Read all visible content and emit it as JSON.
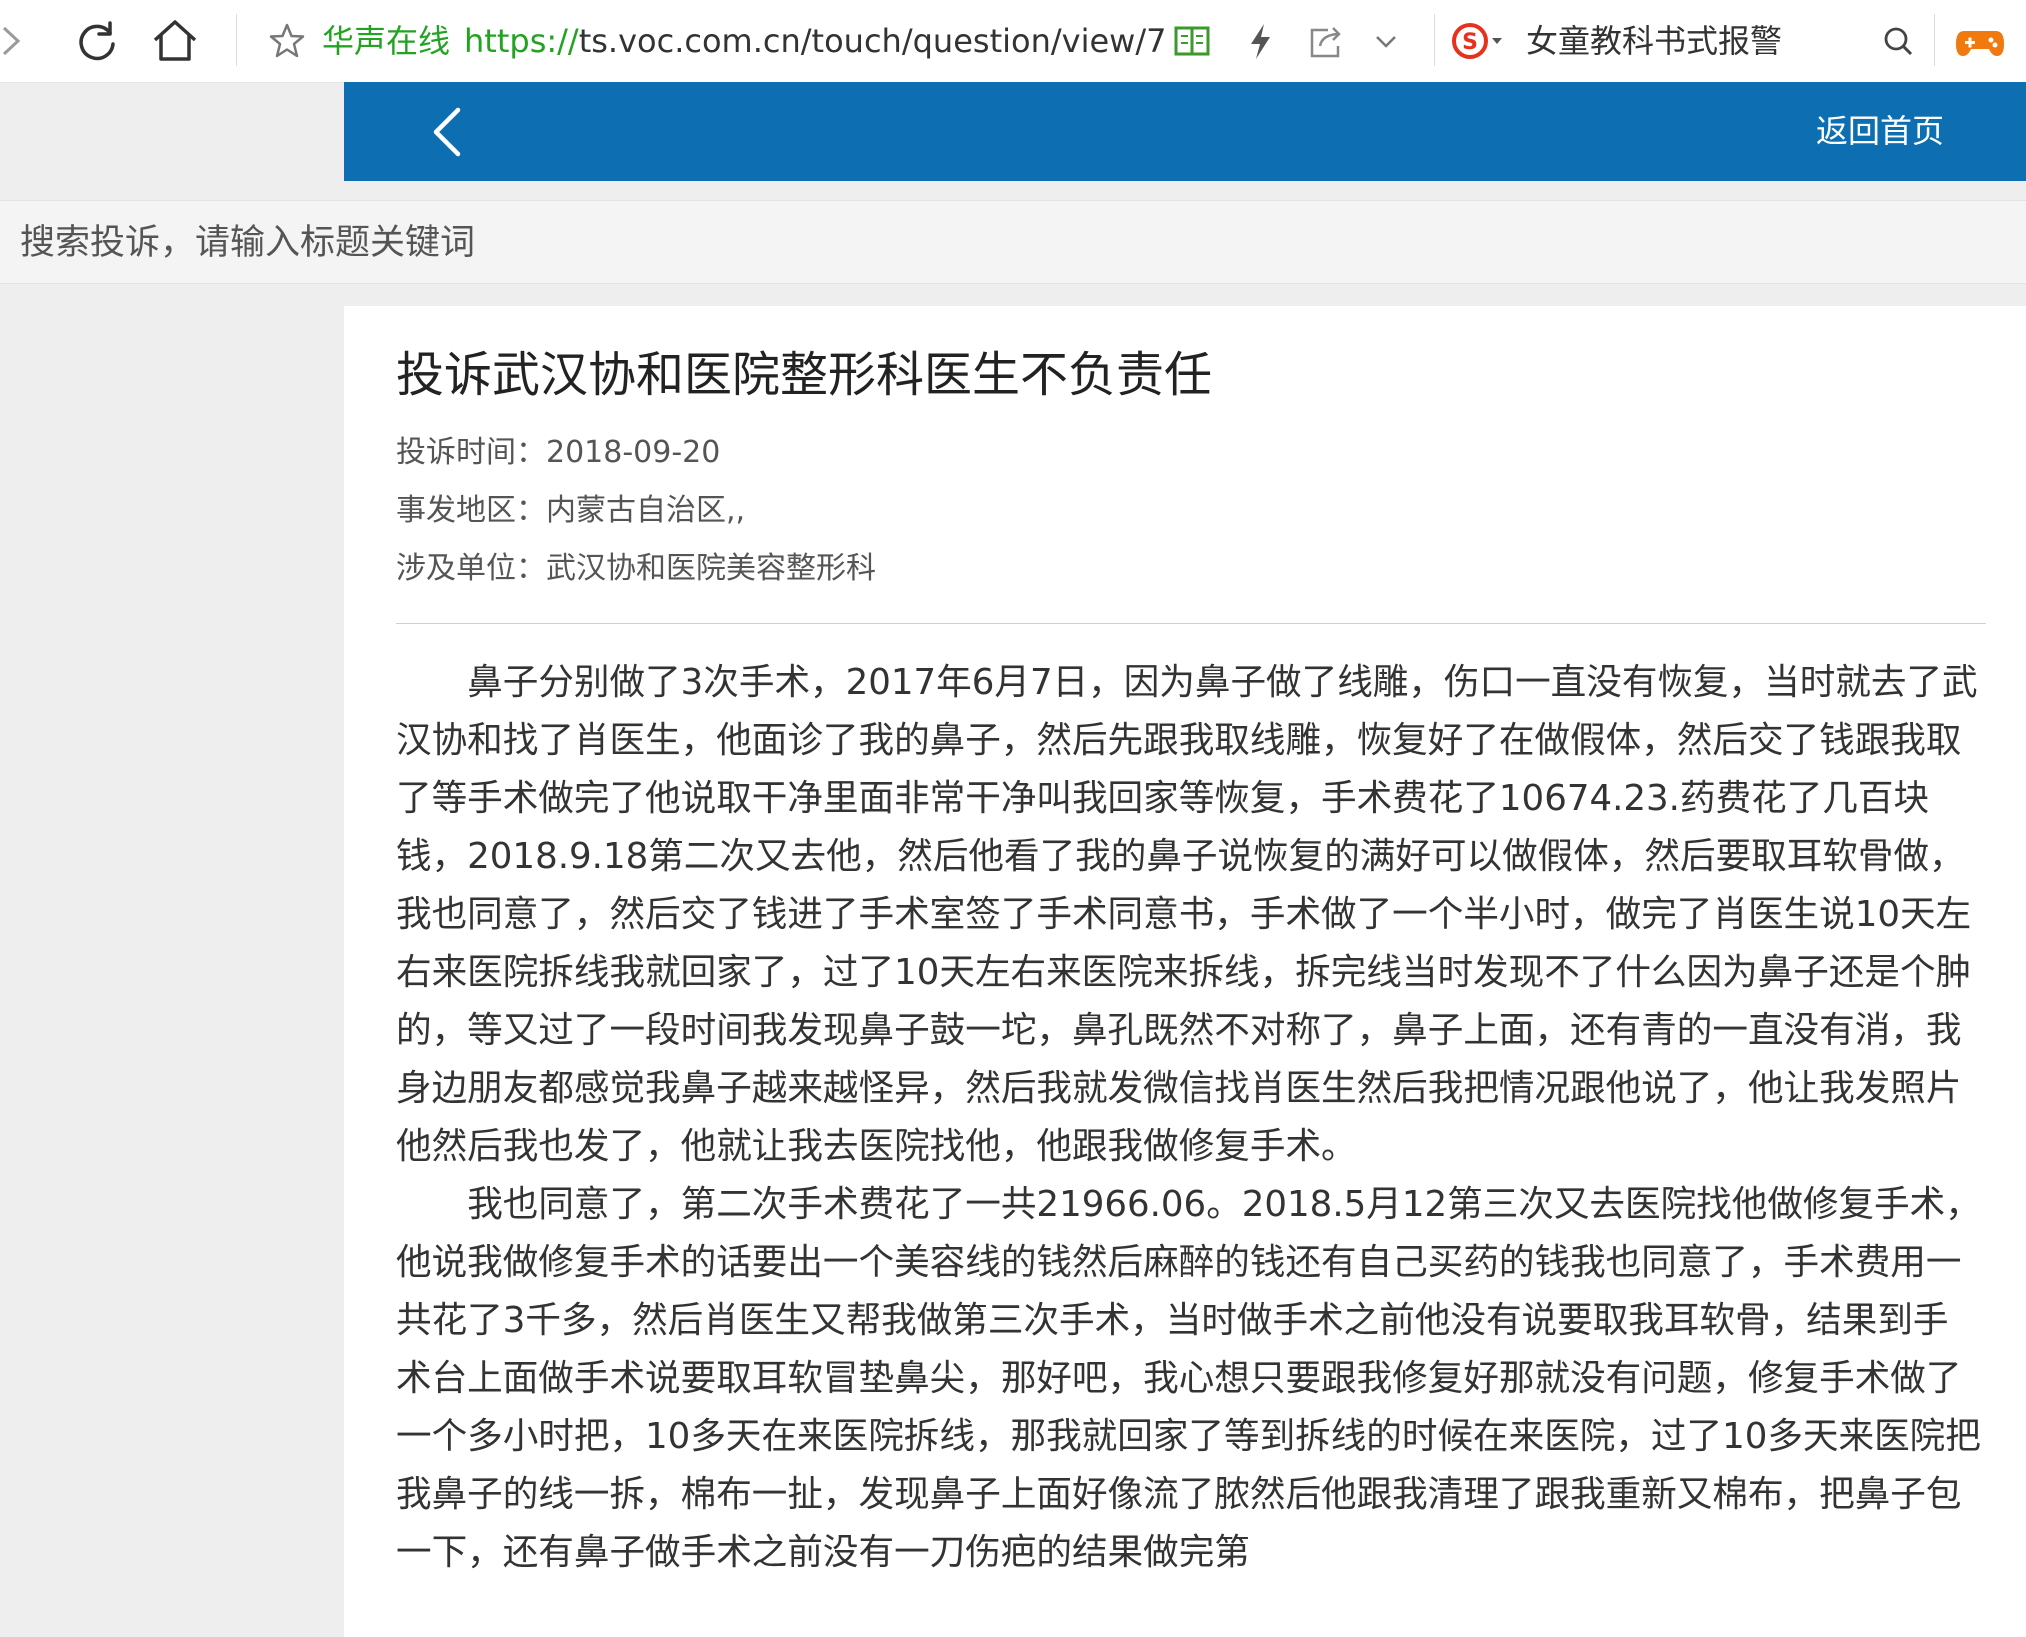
{
  "browser": {
    "site_name": "华声在线",
    "url_scheme": "https://",
    "url_rest": "ts.voc.com.cn/touch/question/view/7",
    "search_engine_text": "女童教科书式报警"
  },
  "header": {
    "home_link": "返回首页"
  },
  "search": {
    "placeholder": "搜索投诉，请输入标题关键词"
  },
  "article": {
    "title": "投诉武汉协和医院整形科医生不负责任",
    "time_label": "投诉时间：",
    "time_value": "2018-09-20",
    "region_label": "事发地区：",
    "region_value": "内蒙古自治区,,",
    "unit_label": "涉及单位：",
    "unit_value": "武汉协和医院美容整形科",
    "paragraphs": [
      "鼻子分别做了3次手术，2017年6月7日，因为鼻子做了线雕，伤口一直没有恢复，当时就去了武汉协和找了肖医生，他面诊了我的鼻子，然后先跟我取线雕，恢复好了在做假体，然后交了钱跟我取了等手术做完了他说取干净里面非常干净叫我回家等恢复，手术费花了10674.23.药费花了几百块钱，2018.9.18第二次又去他，然后他看了我的鼻子说恢复的满好可以做假体，然后要取耳软骨做，我也同意了，然后交了钱进了手术室签了手术同意书，手术做了一个半小时，做完了肖医生说10天左右来医院拆线我就回家了，过了10天左右来医院来拆线，拆完线当时发现不了什么因为鼻子还是个肿的，等又过了一段时间我发现鼻子鼓一坨，鼻孔既然不对称了，鼻子上面，还有青的一直没有消，我身边朋友都感觉我鼻子越来越怪异，然后我就发微信找肖医生然后我把情况跟他说了，他让我发照片他然后我也发了，他就让我去医院找他，他跟我做修复手术。",
      "我也同意了，第二次手术费花了一共21966.06。2018.5月12第三次又去医院找他做修复手术，他说我做修复手术的话要出一个美容线的钱然后麻醉的钱还有自己买药的钱我也同意了，手术费用一共花了3千多，然后肖医生又帮我做第三次手术，当时做手术之前他没有说要取我耳软骨，结果到手术台上面做手术说要取耳软冒垫鼻尖，那好吧，我心想只要跟我修复好那就没有问题，修复手术做了一个多小时把，10多天在来医院拆线，那我就回家了等到拆线的时候在来医院，过了10多天来医院把我鼻子的线一拆，棉布一扯，发现鼻子上面好像流了脓然后他跟我清理了跟我重新又棉布，把鼻子包一下，还有鼻子做手术之前没有一刀伤疤的结果做完第"
    ]
  }
}
